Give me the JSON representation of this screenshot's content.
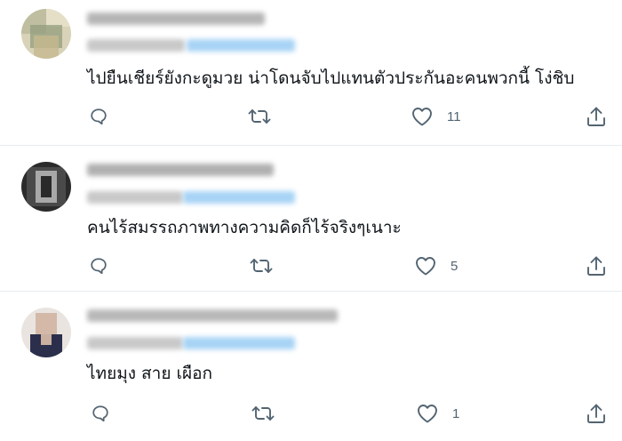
{
  "tweets": [
    {
      "text": "ไปยืนเชียร์ยังกะดูมวย น่าโดนจับไปแทนตัวประกันอะคนพวกนี้ โง่ชิบ",
      "like_count": "11",
      "avatar_palette": [
        "#c9c3a6",
        "#8f9a78",
        "#e8e2cc"
      ]
    },
    {
      "text": "คนไร้สมรรถภาพทางความคิดก็ไร้จริงๆเนาะ",
      "like_count": "5",
      "avatar_palette": [
        "#3b3b3b",
        "#9a9a9a",
        "#1a1a1a"
      ]
    },
    {
      "text": "ไทยมุง สาย เผือก",
      "like_count": "1",
      "avatar_palette": [
        "#d9cfc8",
        "#2a2f4a",
        "#b9a89c"
      ]
    }
  ],
  "icons": {
    "reply": "reply-icon",
    "retweet": "retweet-icon",
    "like": "heart-icon",
    "share": "share-icon"
  },
  "colors": {
    "text": "#0f1419",
    "muted": "#536471",
    "divider": "#e6ecf0",
    "blurred_link": "#a7d3f5"
  }
}
